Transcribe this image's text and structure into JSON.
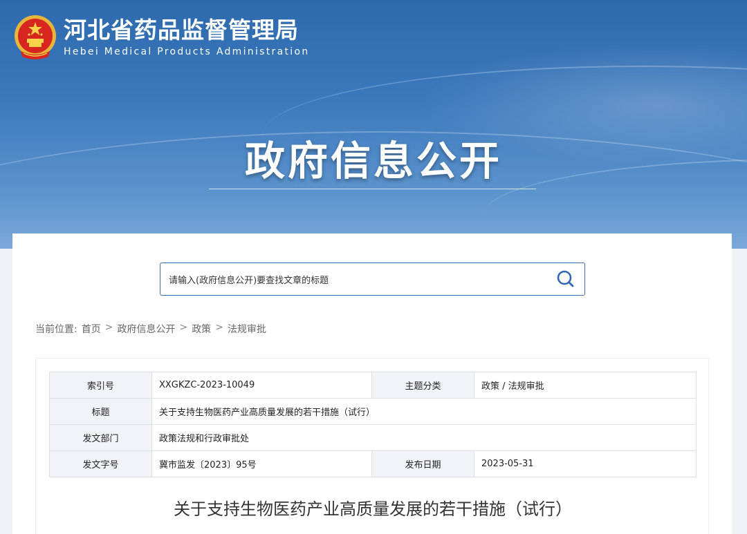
{
  "header": {
    "org_name_cn": "河北省药品监督管理局",
    "org_name_en": "Hebei Medical Products Administration",
    "section_title": "政府信息公开"
  },
  "search": {
    "placeholder": "请输入(政府信息公开)要查找文章的标题"
  },
  "breadcrumb": {
    "label": "当前位置:",
    "items": [
      "首页",
      "政府信息公开",
      "政策",
      "法规审批"
    ],
    "separator": ">"
  },
  "meta": {
    "index_label": "索引号",
    "index_value": "XXGKZC-2023-10049",
    "topic_label": "主题分类",
    "topic_value": "政策 / 法规审批",
    "title_label": "标题",
    "title_value": "关于支持生物医药产业高质量发展的若干措施（试行）",
    "dept_label": "发文部门",
    "dept_value": "政策法规和行政审批处",
    "docno_label": "发文字号",
    "docno_value": "冀市监发〔2023〕95号",
    "date_label": "发布日期",
    "date_value": "2023-05-31"
  },
  "article": {
    "title": "关于支持生物医药产业高质量发展的若干措施（试行）"
  },
  "colors": {
    "banner": "#3b78bc",
    "accent": "#3a6fb5"
  }
}
